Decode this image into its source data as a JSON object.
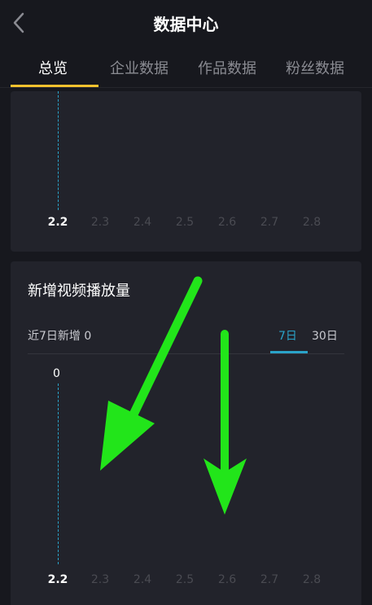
{
  "header": {
    "title": "数据中心",
    "back_icon": "chevron-left-icon"
  },
  "tabs": [
    {
      "label": "总览",
      "active": true
    },
    {
      "label": "企业数据",
      "active": false
    },
    {
      "label": "作品数据",
      "active": false
    },
    {
      "label": "粉丝数据",
      "active": false
    }
  ],
  "top_card": {
    "x_labels": [
      "2.2",
      "2.3",
      "2.4",
      "2.5",
      "2.6",
      "2.7",
      "2.8"
    ]
  },
  "video_plays_card": {
    "title": "新增视频播放量",
    "summary": "近7日新增 0",
    "range_options": [
      "7日",
      "30日"
    ],
    "selected_range": "7日",
    "y_value_label": "0",
    "x_labels": [
      "2.2",
      "2.3",
      "2.4",
      "2.5",
      "2.6",
      "2.7",
      "2.8"
    ]
  },
  "colors": {
    "background": "#17181e",
    "card": "#22232b",
    "accent_tab": "#f5c12e",
    "accent_chart": "#2aa3c9",
    "annotation_arrow": "#22e51a"
  },
  "annotations": {
    "arrow_icon_1": "arrow-down-left-icon",
    "arrow_icon_2": "arrow-down-icon"
  }
}
